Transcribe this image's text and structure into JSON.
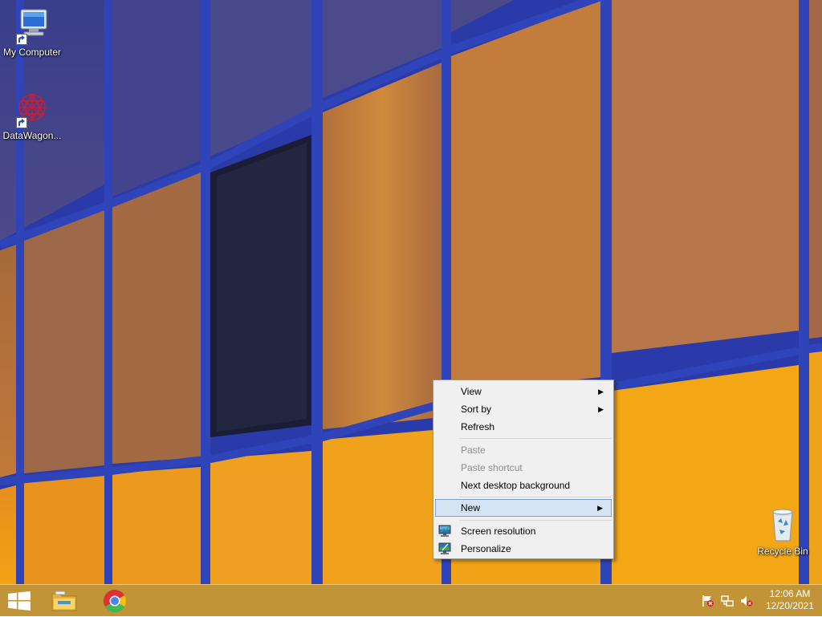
{
  "desktop": {
    "icons": [
      {
        "label": "My Computer",
        "icon": "my-computer-icon"
      },
      {
        "label": "DataWagon...",
        "icon": "datawagon-icon"
      },
      {
        "label": "Recycle Bin",
        "icon": "recycle-bin-icon"
      }
    ]
  },
  "context_menu": {
    "items": [
      {
        "label": "View",
        "submenu": true,
        "enabled": true
      },
      {
        "label": "Sort by",
        "submenu": true,
        "enabled": true
      },
      {
        "label": "Refresh",
        "enabled": true
      },
      {
        "label": "Paste",
        "enabled": false
      },
      {
        "label": "Paste shortcut",
        "enabled": false
      },
      {
        "label": "Next desktop background",
        "enabled": true
      },
      {
        "label": "New",
        "submenu": true,
        "enabled": true,
        "highlighted": true
      },
      {
        "label": "Screen resolution",
        "enabled": true,
        "icon": "display-icon"
      },
      {
        "label": "Personalize",
        "enabled": true,
        "icon": "personalize-icon"
      }
    ],
    "submenu_arrow": "▶"
  },
  "taskbar": {
    "start_icon": "windows-logo-icon",
    "pinned": [
      {
        "icon": "file-explorer-icon"
      },
      {
        "icon": "chrome-icon"
      }
    ],
    "tray": [
      {
        "icon": "action-center-flag-icon"
      },
      {
        "icon": "network-icon"
      },
      {
        "icon": "volume-muted-icon"
      }
    ],
    "clock": {
      "time": "12:06 AM",
      "date": "12/20/2021"
    }
  },
  "colors": {
    "menu_bg": "#f0f0f0",
    "menu_highlight": "#d5e3f3",
    "menu_highlight_border": "#7ba4d4",
    "taskbar": "#d7a028",
    "wall_frame_blue": "#2f44b8"
  }
}
